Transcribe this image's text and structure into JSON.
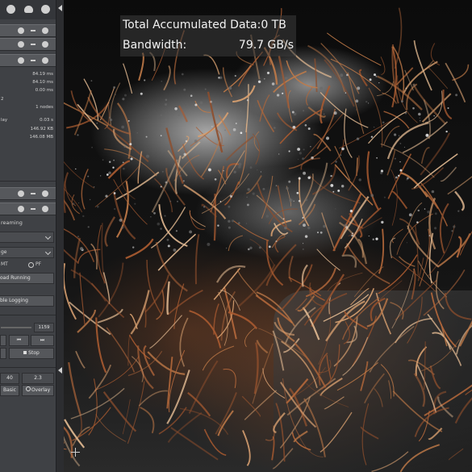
{
  "overlay": {
    "accumulated_label": "Total Accumulated Data:",
    "accumulated_value": "0 TB",
    "bandwidth_label": "Bandwidth:",
    "bandwidth_value": "79.7 GB/s"
  },
  "sidebar": {
    "stats": [
      {
        "label": "",
        "value": "84.19 ms",
        "value_color": "normal"
      },
      {
        "label": "",
        "value": "84.10 ms",
        "value_color": "normal"
      },
      {
        "label": "",
        "value": "0.00 ms",
        "value_color": "normal"
      },
      {
        "label": "2",
        "value": "",
        "value_color": "orange"
      },
      {
        "label": "",
        "value": "1 nodes",
        "value_color": "normal"
      },
      {
        "label": "",
        "value": "",
        "value_color": "normal"
      },
      {
        "label": "lay",
        "value": "0.03 s",
        "value_color": "normal"
      },
      {
        "label": "",
        "value": "146.92 KB",
        "value_color": "normal"
      },
      {
        "label": "",
        "value": "146.08 MB",
        "value_color": "normal"
      },
      {
        "label": "",
        "value": "",
        "value_color": "orange"
      }
    ],
    "streaming_label": "reaming",
    "stage_label": "ge",
    "mt_label": "MT",
    "pf_label": "PF",
    "pause_label": "oad Running",
    "logging_label": "ble Logging",
    "frame_value": "1159",
    "stop_label": "Stop",
    "field_a": "40",
    "field_b": "2.3",
    "basic_label": "Basic",
    "overlay_label": "Overlay"
  },
  "colors": {
    "panel": "#3f4145",
    "header": "#56585c",
    "warning": "#d06a1a"
  }
}
